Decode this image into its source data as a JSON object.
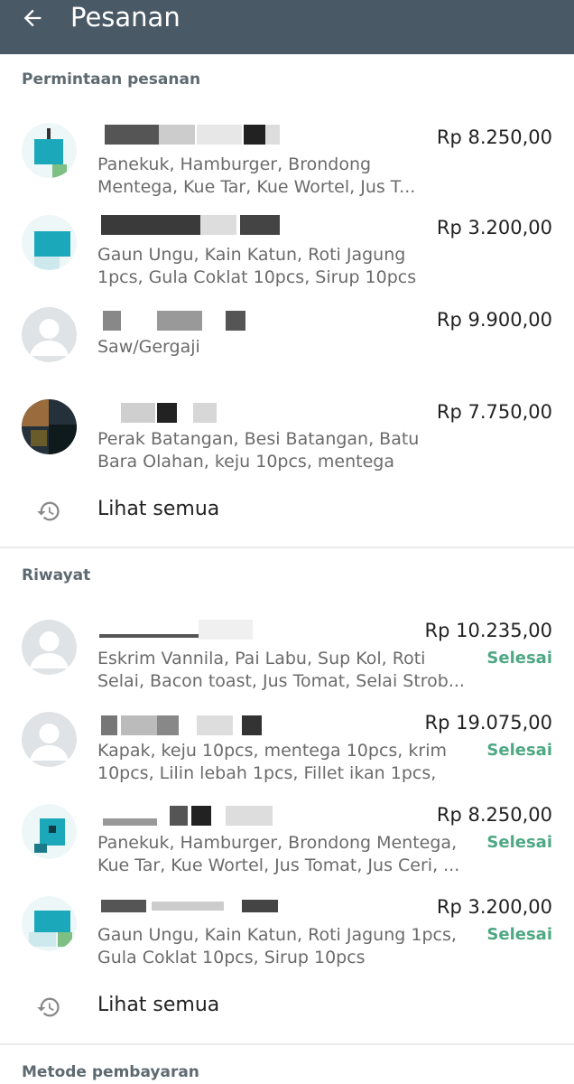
{
  "appbar": {
    "title": "Pesanan",
    "back_icon": "arrow-left-icon"
  },
  "colors": {
    "appbar": "#4a5966",
    "status": "#4fa884",
    "section_title": "#5d6a72"
  },
  "requests": {
    "title": "Permintaan pesanan",
    "items": [
      {
        "price": "Rp 8.250,00",
        "description": "Panekuk, Hamburger, Brondong Mentega, Kue Tar, Kue Wortel, Jus T..."
      },
      {
        "price": "Rp 3.200,00",
        "description": "Gaun Ungu, Kain Katun, Roti Jagung 1pcs, Gula Coklat 10pcs, Sirup 10pcs"
      },
      {
        "price": "Rp 9.900,00",
        "description": "Saw/Gergaji"
      },
      {
        "price": "Rp 7.750,00",
        "description": "Perak Batangan, Besi Batangan, Batu Bara Olahan, keju 10pcs, mentega 1..."
      }
    ],
    "see_all": "Lihat semua",
    "see_all_icon": "history-icon"
  },
  "history": {
    "title": "Riwayat",
    "items": [
      {
        "price": "Rp 10.235,00",
        "description": "Eskrim Vannila, Pai Labu, Sup Kol, Roti Selai, Bacon toast, Jus Tomat, Selai Strob...",
        "status": "Selesai"
      },
      {
        "price": "Rp 19.075,00",
        "description": "Kapak, keju 10pcs, mentega 10pcs, krim 10pcs, Lilin lebah 1pcs, Fillet ikan 1pcs, E...",
        "status": "Selesai"
      },
      {
        "price": "Rp 8.250,00",
        "description": "Panekuk, Hamburger, Brondong Mentega, Kue Tar, Kue Wortel, Jus Tomat, Jus Ceri, ...",
        "status": "Selesai"
      },
      {
        "price": "Rp 3.200,00",
        "description": "Gaun Ungu, Kain Katun, Roti Jagung 1pcs, Gula Coklat 10pcs, Sirup 10pcs",
        "status": "Selesai"
      }
    ],
    "see_all": "Lihat semua",
    "see_all_icon": "history-icon"
  },
  "payment": {
    "title": "Metode pembayaran"
  }
}
